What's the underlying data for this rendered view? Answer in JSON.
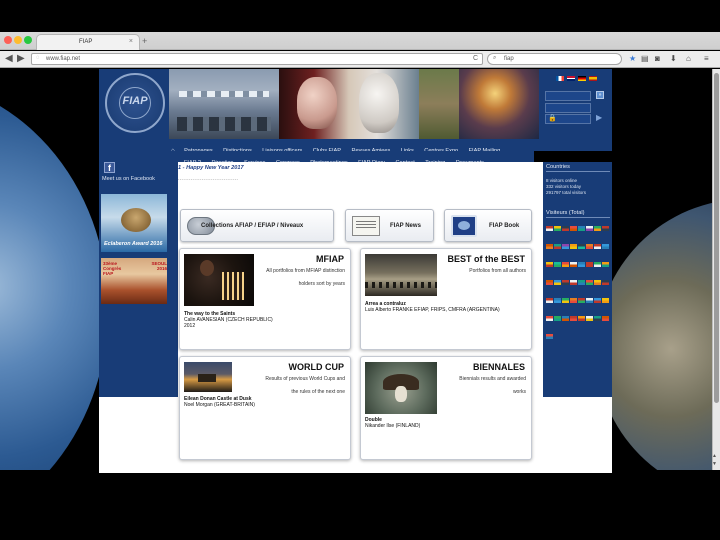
{
  "browser": {
    "tab_title": "FIAP",
    "tab_close": "×",
    "new_tab": "+",
    "back": "◀",
    "forward": "▶",
    "url": "www.fiap.net",
    "reload": "C",
    "search_value": "fiap",
    "bookmark_star": "★",
    "toolbar_icons": [
      "bookmark-list-icon",
      "pocket-icon",
      "download-icon",
      "home-icon",
      "menu-icon"
    ]
  },
  "header": {
    "logo_text": "FIAP",
    "search_go": "»",
    "login_go": "▶"
  },
  "nav_primary": [
    "Patronages",
    "Distinctions",
    "Liaisons officers",
    "Clubs FIAP",
    "Revues Amiees",
    "Links",
    "Centres Expo",
    "FIAP Mailing"
  ],
  "nav_secondary": [
    "FIAP ?",
    "Direction",
    "Services",
    "Congress",
    "Photomeetings",
    "FIAP Diary",
    "Contest",
    "Training",
    "Documents"
  ],
  "left_column": {
    "facebook_letter": "f",
    "facebook_text": "Meet us on Facebook",
    "award_text": "Eclaberon Award 2016",
    "promo_left": "33ème Congrès FIAP",
    "promo_right": "SEOUL 2016"
  },
  "right_column": {
    "countries_title": "Countries",
    "online": "8 visitors online",
    "today": "332 visitors today",
    "total": "291797 total visitors",
    "visitors_title": "Visiteurs (Total)"
  },
  "main": {
    "happy": "1 - Happy New Year 2017",
    "dash": "---------------------------------",
    "quick_buttons": {
      "collections": "Collections AFIAP / EFIAP / Niveaux",
      "news": "FIAP News",
      "book": "FIAP Book"
    },
    "cards": {
      "mfiap": {
        "title": "MFIAP",
        "desc": "All portfolios from MFIAP distinction holders sort by years",
        "caption_title": "The way to the Saints",
        "caption_author": "Calin AVANESIAN (CZECH REPUBLIC)",
        "caption_year": "2012"
      },
      "best": {
        "title": "BEST of the BEST",
        "desc": "Portfolios from all authors",
        "caption_title": "Arrea a contraluz",
        "caption_author": "Luis Alberto FRANKE  EFIAP, FRIPS, CMFRA (ARGENTINA)"
      },
      "worldcup": {
        "title": "WORLD CUP",
        "desc": "Results of previous World Cups and the rules of the next one",
        "caption_title": "Eilean Donan Castle at Dusk",
        "caption_author": "Noel Morgan (GREAT-BRITAIN)"
      },
      "biennales": {
        "title": "BIENNALES",
        "desc": "Biennials results and awarded works",
        "caption_title": "Double",
        "caption_author": "Nikander Ilse (FINLAND)"
      }
    }
  },
  "colors": {
    "site_blue": "#183c77",
    "chrome_gray": "#ececec",
    "title_blue": "#1f3f86"
  },
  "flags": [
    "#c0392b",
    "#f1c40f",
    "#2c3e50",
    "#e74c3c",
    "#2980b9",
    "#ecf0f1",
    "#27ae60",
    "#c0392b",
    "#d35400",
    "#16a085",
    "#8e44ad",
    "#f39c12",
    "#2c3e50",
    "#e67e22",
    "#c0392b",
    "#3498db",
    "#f1c40f",
    "#1abc9c",
    "#e74c3c",
    "#ecf0f1",
    "#2980b9",
    "#c0392b",
    "#27ae60",
    "#f39c12",
    "#d35400",
    "#3498db",
    "#c0392b",
    "#ecf0f1",
    "#16a085",
    "#e74c3c",
    "#f1c40f",
    "#2c3e50",
    "#c0392b",
    "#2980b9",
    "#27ae60",
    "#e67e22",
    "#c0392b",
    "#ecf0f1",
    "#3498db",
    "#f1c40f",
    "#e74c3c",
    "#27ae60",
    "#2980b9",
    "#c0392b",
    "#f39c12",
    "#ecf0f1",
    "#16a085",
    "#d35400",
    "#e74c3c"
  ]
}
